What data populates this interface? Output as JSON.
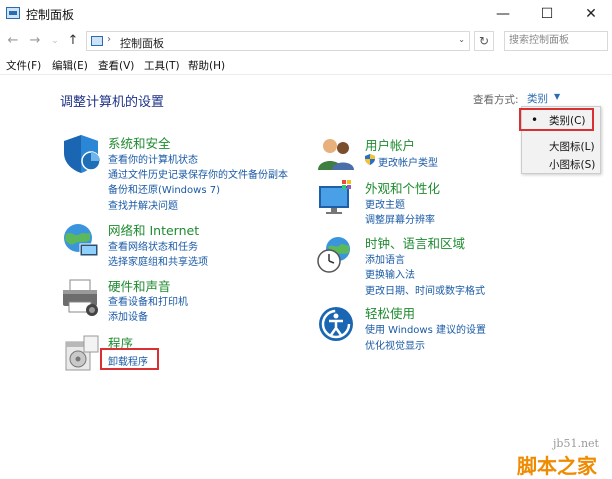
{
  "window": {
    "title": "控制面板",
    "minimize_glyph": "—",
    "maximize_glyph": "☐",
    "close_glyph": "✕"
  },
  "address": {
    "back_glyph": "←",
    "forward_glyph": "→",
    "up_glyph": "↑",
    "sep": "›",
    "path": "控制面板",
    "dropdown_glyph": "⌄",
    "refresh_glyph": "↻",
    "search_placeholder": "搜索控制面板"
  },
  "menu": [
    "文件(F)",
    "编辑(E)",
    "查看(V)",
    "工具(T)",
    "帮助(H)"
  ],
  "heading": "调整计算机的设置",
  "view_by": {
    "label": "查看方式:",
    "value": "类别",
    "arrow": "▼",
    "options": [
      "类别(C)",
      "大图标(L)",
      "小图标(S)"
    ],
    "selected_bullet": "•"
  },
  "categories": {
    "system": {
      "title": "系统和安全",
      "links": [
        "查看你的计算机状态",
        "通过文件历史记录保存你的文件备份副本",
        "备份和还原(Windows 7)",
        "查找并解决问题"
      ]
    },
    "network": {
      "title": "网络和 Internet",
      "links": [
        "查看网络状态和任务",
        "选择家庭组和共享选项"
      ]
    },
    "hardware": {
      "title": "硬件和声音",
      "links": [
        "查看设备和打印机",
        "添加设备"
      ]
    },
    "programs": {
      "title": "程序",
      "links": [
        "卸载程序"
      ]
    },
    "accounts": {
      "title": "用户帐户",
      "links": [
        "更改帐户类型"
      ]
    },
    "appearance": {
      "title": "外观和个性化",
      "links": [
        "更改主题",
        "调整屏幕分辨率"
      ]
    },
    "clock": {
      "title": "时钟、语言和区域",
      "links": [
        "添加语言",
        "更换输入法",
        "更改日期、时间或数字格式"
      ]
    },
    "ease": {
      "title": "轻松使用",
      "links": [
        "使用 Windows 建议的设置",
        "优化视觉显示"
      ]
    }
  },
  "watermark": {
    "top": "jb51.net",
    "bottom": "脚本之家"
  },
  "colors": {
    "link": "#1a5aa6",
    "category": "#1e8b2f",
    "heading": "#1e3287",
    "highlight": "#d93131"
  }
}
